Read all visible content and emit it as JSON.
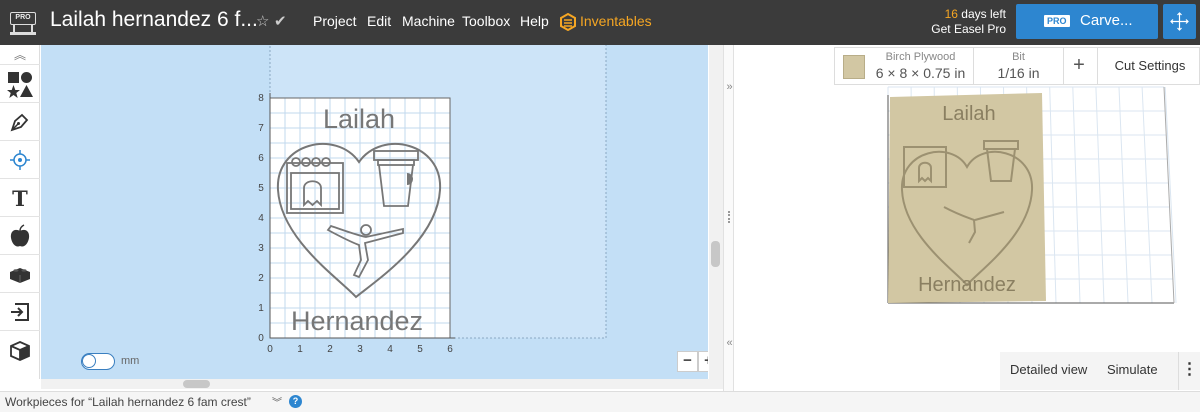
{
  "header": {
    "logo_badge": "PRO",
    "project_title": "Lailah hernandez 6 f...",
    "menu": [
      "Project",
      "Edit",
      "Machine",
      "Toolbox",
      "Help"
    ],
    "inventables_label": "Inventables",
    "trial_days": "16",
    "trial_suffix": "days left",
    "trial_cta": "Get Easel Pro",
    "carve_badge": "PRO",
    "carve_label": "Carve...",
    "accent_color": "#2d86d0",
    "inventables_color": "#f5a623"
  },
  "toolbar": {
    "icons": [
      "shapes-icon",
      "pen-icon",
      "point-icon",
      "text-icon",
      "apple-icon",
      "lego-icon",
      "import-icon",
      "cube-icon"
    ]
  },
  "canvas": {
    "unit_label": "mm",
    "y_ticks": [
      "8",
      "7",
      "6",
      "5",
      "4",
      "3",
      "2",
      "1",
      "0"
    ],
    "x_ticks": [
      "0",
      "1",
      "2",
      "3",
      "4",
      "5",
      "6"
    ],
    "design_top_text": "Lailah",
    "design_bottom_text": "Hernandez",
    "zoom_out": "−",
    "zoom_in": "+",
    "background_color": "#c3dff6"
  },
  "preview": {
    "material_name": "Birch Plywood",
    "material_size": "6 × 8 × 0.75 in",
    "bit_label": "Bit",
    "bit_size": "1/16 in",
    "add_label": "+",
    "cut_settings": "Cut Settings",
    "detailed_view": "Detailed view",
    "simulate": "Simulate",
    "more": "⋮",
    "top_text": "Lailah",
    "bottom_text": "Hernandez",
    "wood_color": "#d2c7a3"
  },
  "footer": {
    "workpieces_label": "Workpieces for “Lailah hernandez 6 fam crest”",
    "help": "?"
  }
}
